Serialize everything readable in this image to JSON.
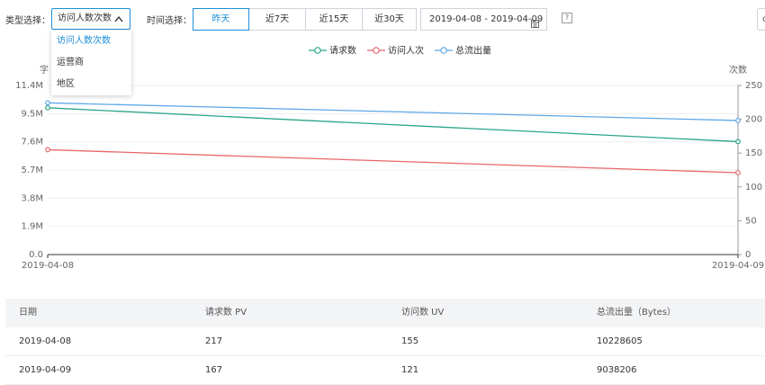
{
  "filters": {
    "type_label": "类型选择：",
    "type_value": "访问人数次数",
    "type_options": [
      "访问人数次数",
      "运营商",
      "地区"
    ],
    "time_label": "时间选择：",
    "quick_ranges": [
      "昨天",
      "近7天",
      "近15天",
      "近30天"
    ],
    "active_range_index": 0,
    "date_range": "2019-04-08 - 2019-04-09",
    "help_symbol": "?",
    "edge_button_symbol": "c"
  },
  "chart_data": {
    "type": "line",
    "x": [
      "2019-04-08",
      "2019-04-09"
    ],
    "series": [
      {
        "name": "请求数",
        "axis": "right",
        "color": "#2aa58a",
        "values": [
          217,
          167
        ]
      },
      {
        "name": "访问人次",
        "axis": "right",
        "color": "#e8676a",
        "values": [
          155,
          121
        ]
      },
      {
        "name": "总流出量",
        "axis": "left",
        "color": "#5ea8e8",
        "values": [
          10228605,
          9038206
        ]
      }
    ],
    "y_left": {
      "label": "字",
      "ticks": [
        "0.0",
        "1.9M",
        "3.8M",
        "5.7M",
        "7.6M",
        "9.5M",
        "11.4M"
      ],
      "range": [
        0,
        11400000
      ]
    },
    "y_right": {
      "label": "次数",
      "ticks": [
        "0",
        "50",
        "100",
        "150",
        "200",
        "250"
      ],
      "range": [
        0,
        250
      ]
    },
    "legend_position": "top-center",
    "grid": true
  },
  "table": {
    "columns": [
      "日期",
      "请求数 PV",
      "访问数 UV",
      "总流出量（Bytes）"
    ],
    "rows": [
      [
        "2019-04-08",
        "217",
        "155",
        "10228605"
      ],
      [
        "2019-04-09",
        "167",
        "121",
        "9038206"
      ]
    ]
  }
}
